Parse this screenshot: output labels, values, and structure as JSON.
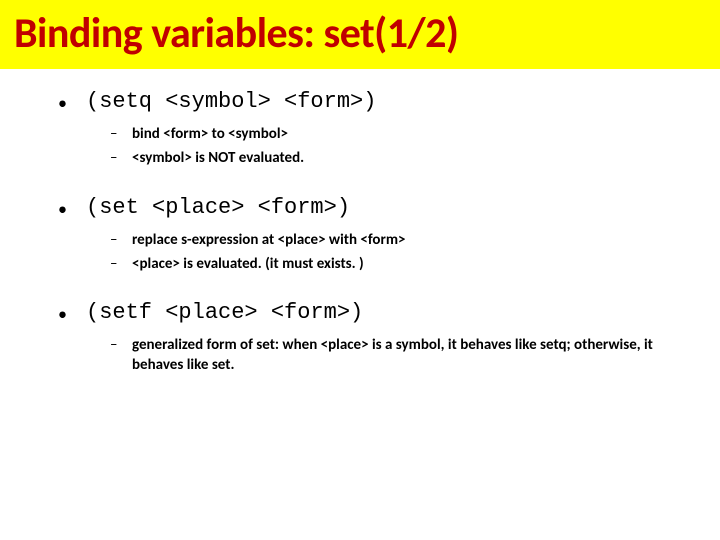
{
  "title": "Binding variables: set(1/2)",
  "items": [
    {
      "code": "(setq <symbol> <form>)",
      "subs": [
        "bind <form> to <symbol>",
        "<symbol> is NOT evaluated."
      ]
    },
    {
      "code": "(set <place> <form>)",
      "subs": [
        "replace s-expression at <place> with <form>",
        "<place> is evaluated. (it must exists. )"
      ]
    },
    {
      "code": "(setf <place> <form>)",
      "subs": [
        "generalized form of set: when <place> is a symbol, it behaves like setq; otherwise, it behaves like set."
      ]
    }
  ]
}
